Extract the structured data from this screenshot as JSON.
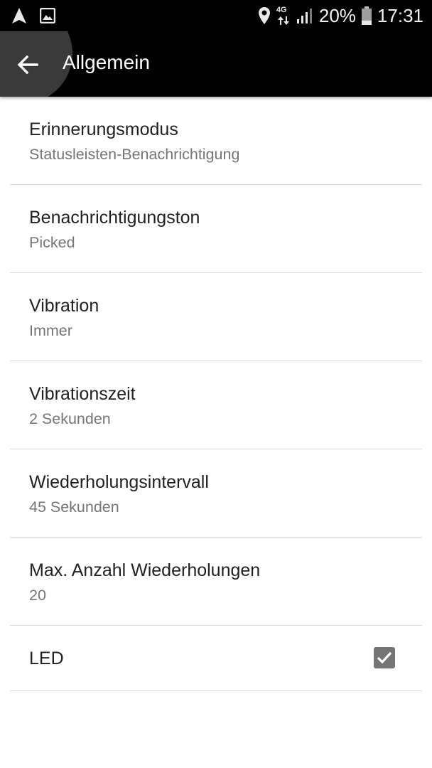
{
  "status_bar": {
    "network_type": "4G",
    "battery_percent": "20%",
    "time": "17:31",
    "icons": [
      "navigation-icon",
      "image-icon",
      "location-icon",
      "data-arrows-icon",
      "signal-icon",
      "battery-icon"
    ]
  },
  "app_bar": {
    "title": "Allgemein",
    "back_icon": "arrow-back-icon"
  },
  "preferences": [
    {
      "title": "Erinnerungsmodus",
      "summary": "Statusleisten-Benachrichtigung"
    },
    {
      "title": "Benachrichtigungston",
      "summary": "Picked"
    },
    {
      "title": "Vibration",
      "summary": "Immer"
    },
    {
      "title": "Vibrationszeit",
      "summary": "2 Sekunden"
    },
    {
      "title": "Wiederholungsintervall",
      "summary": "45 Sekunden"
    },
    {
      "title": "Max. Anzahl Wiederholungen",
      "summary": "20"
    },
    {
      "title": "LED",
      "checked": true
    }
  ],
  "colors": {
    "bar_background": "#000000",
    "title_text": "#212121",
    "summary_text": "#757575",
    "divider": "#dcdcdc",
    "checkbox": "#757575"
  }
}
